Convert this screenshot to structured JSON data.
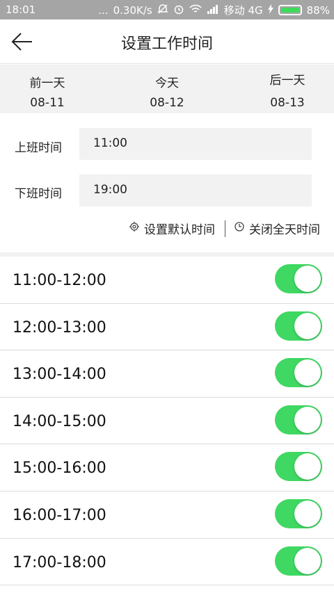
{
  "status_bar": {
    "time": "18:01",
    "dots": "...",
    "speed": "0.30K/s",
    "carrier": "移动 4G",
    "battery": "88%"
  },
  "header": {
    "title": "设置工作时间"
  },
  "days": [
    {
      "name": "前一天",
      "date": "08-11"
    },
    {
      "name": "今天",
      "date": "08-12"
    },
    {
      "name": "后一天",
      "date": "08-13"
    }
  ],
  "form": {
    "start_label": "上班时间",
    "start_value": "11:00",
    "end_label": "下班时间",
    "end_value": "19:00"
  },
  "actions": {
    "set_default": "设置默认时间",
    "close_all_day": "关闭全天时间"
  },
  "slots": [
    {
      "label": "11:00-12:00",
      "on": true
    },
    {
      "label": "12:00-13:00",
      "on": true
    },
    {
      "label": "13:00-14:00",
      "on": true
    },
    {
      "label": "14:00-15:00",
      "on": true
    },
    {
      "label": "15:00-16:00",
      "on": true
    },
    {
      "label": "16:00-17:00",
      "on": true
    },
    {
      "label": "17:00-18:00",
      "on": true
    }
  ],
  "colors": {
    "toggle_on": "#3fd862",
    "statusbar": "#a5a5a5",
    "panel": "#f2f2f2"
  }
}
